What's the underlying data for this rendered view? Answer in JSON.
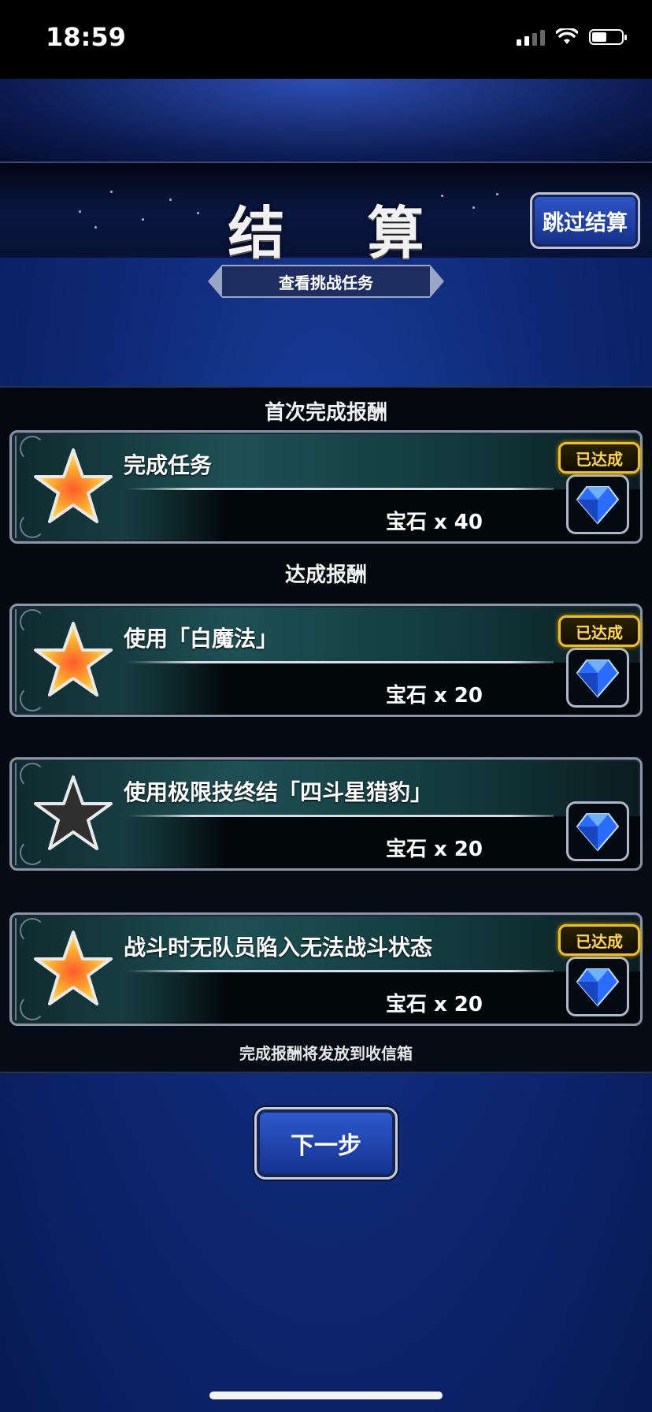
{
  "status_bar": {
    "time": "18:59"
  },
  "header": {
    "title": "结 算",
    "skip_label": "跳过结算",
    "task_tab_label": "查看挑战任务"
  },
  "sections": {
    "first_clear": "首次完成报酬",
    "achievement": "达成报酬"
  },
  "missions": [
    {
      "title": "完成任务",
      "reward": "宝石 x 40",
      "achieved": true,
      "badge": "已达成"
    },
    {
      "title": "使用「白魔法」",
      "reward": "宝石 x 20",
      "achieved": true,
      "badge": "已达成"
    },
    {
      "title": "使用极限技终结「四斗星猎豹」",
      "reward": "宝石 x 20",
      "achieved": false,
      "badge": ""
    },
    {
      "title": "战斗时无队员陷入无法战斗状态",
      "reward": "宝石 x 20",
      "achieved": true,
      "badge": "已达成"
    }
  ],
  "footer_note": "完成报酬将发放到收信箱",
  "next_label": "下一步",
  "colors": {
    "badge_gold": "#f0c020",
    "button_blue": "#2f5bd0",
    "card_teal": "#1e5053",
    "background_blue": "#0f2a78"
  }
}
